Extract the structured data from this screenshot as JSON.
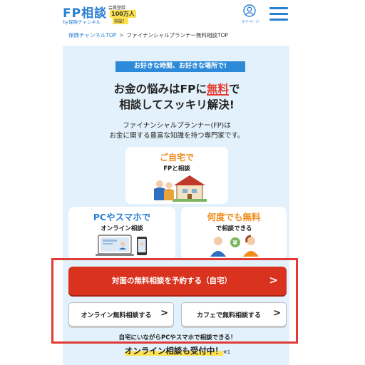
{
  "header": {
    "logo_main": "FP相談",
    "logo_sub": "by保険チャンネル",
    "badge_line1": "会員登録",
    "badge_line2": "100万人",
    "badge_line3": "突破！",
    "mypage_label": "マイページ"
  },
  "breadcrumb": {
    "home": "保険チャンネルTOP",
    "separator": ">",
    "current": "ファイナンシャルプランナー無料相談TOP"
  },
  "hero": {
    "tagline": "お好きな時間、お好きな場所で!",
    "headline_part1": "お金の悩みはFPに",
    "headline_accent": "無料",
    "headline_part2": "で",
    "headline_line2": "相談してスッキリ解決!",
    "desc_line1": "ファイナンシャルプランナー(FP)は",
    "desc_line2": "お金に関する豊富な知識を持つ専門家です。"
  },
  "cards": {
    "home": {
      "title": "ご自宅で",
      "sub": "FPと相談"
    },
    "online": {
      "title": "PCやスマホで",
      "sub": "オンライン相談"
    },
    "free": {
      "title": "何度でも無料",
      "sub": "で相談できる"
    }
  },
  "actions": {
    "primary": "対面の無料相談を予約する（自宅）",
    "online": "オンライン無料相談する",
    "cafe": "カフェで無料相談する"
  },
  "bottom": {
    "line1": "自宅にいながらPCやスマホで相談できる！",
    "line2": "オンライン相談も受付中！",
    "note": "※1"
  },
  "colors": {
    "brand_blue": "#2a7fd1",
    "cta_red": "#d9321f",
    "accent_red": "#e63b2e",
    "accent_orange": "#f08d1e",
    "panel_bg": "#e2f1fb",
    "highlight_border": "#e03b36"
  }
}
